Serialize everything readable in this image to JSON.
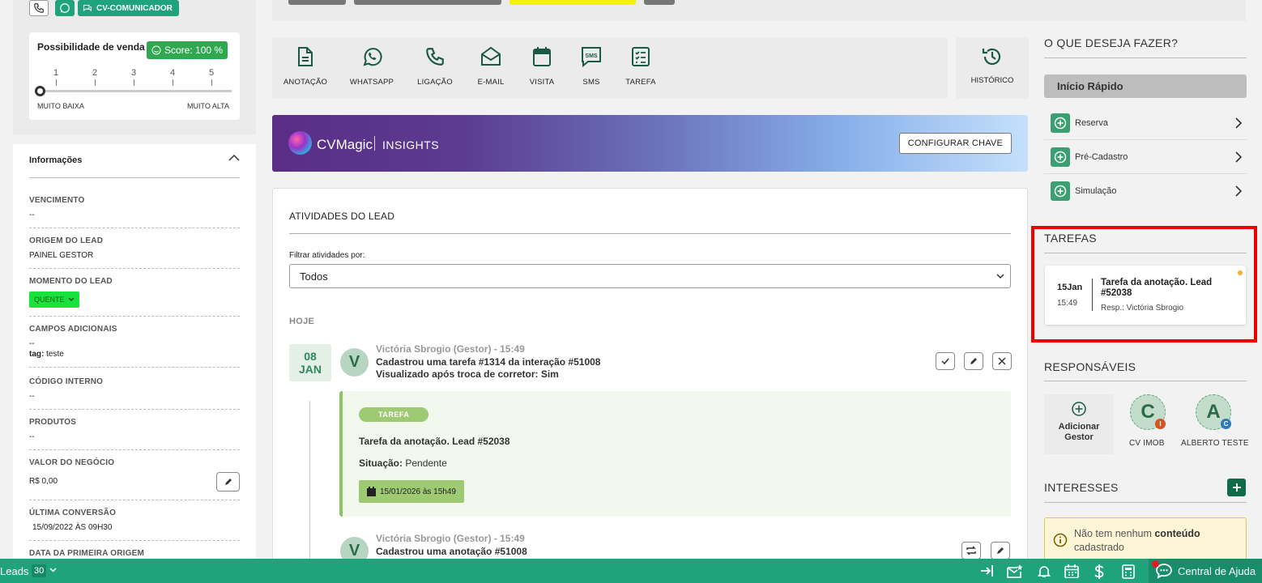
{
  "left_top": {
    "cv_comunicador": "CV-COMUNICADOR",
    "score_title": "Possibilidade de venda",
    "score_badge": "Score: 100 %",
    "scale": [
      "1",
      "2",
      "3",
      "4",
      "5"
    ],
    "scale_min": "MUITO BAIXA",
    "scale_max": "MUITO ALTA",
    "scale_value": 0
  },
  "info": {
    "title": "Informações",
    "vencimento_label": "VENCIMENTO",
    "vencimento_value": "--",
    "origem_label": "ORIGEM DO LEAD",
    "origem_value": "PAINEL GESTOR",
    "momento_label": "MOMENTO DO LEAD",
    "momento_value": "QUENTE",
    "campos_label": "CAMPOS ADICIONAIS",
    "campos_value": "--",
    "tag_label": "tag:",
    "tag_value": "teste",
    "codigo_label": "CÓDIGO INTERNO",
    "codigo_value": "--",
    "produtos_label": "PRODUTOS",
    "produtos_value": "--",
    "valor_label": "VALOR DO NEGÓCIO",
    "valor_value": "R$ 0,00",
    "ultima_label": "ÚLTIMA CONVERSÃO",
    "ultima_value": "15/09/2022 ÀS 09H30",
    "primeira_label": "DATA DA PRIMEIRA ORIGEM"
  },
  "actions": {
    "anotacao": "ANOTAÇÃO",
    "whatsapp": "WHATSAPP",
    "ligacao": "LIGAÇÃO",
    "email": "E-MAIL",
    "visita": "VISITA",
    "sms": "SMS",
    "tarefa": "TAREFA",
    "historico": "HISTÓRICO"
  },
  "magic": {
    "brand": "CVMagic",
    "insights": "INSIGHTS",
    "config_button": "CONFIGURAR CHAVE"
  },
  "activities": {
    "title": "ATIVIDADES DO LEAD",
    "filter_label": "Filtrar atividades por:",
    "filter_value": "Todos",
    "today": "HOJE",
    "date_day": "08",
    "date_month": "JAN",
    "entry1": {
      "avatar": "V",
      "author": "Victória Sbrogio (Gestor) - 15:49",
      "line1": "Cadastrou uma tarefa #1314 da interação #51008",
      "line2": "Visualizado após troca de corretor:  Sim"
    },
    "task": {
      "pill": "TAREFA",
      "title": "Tarefa da anotação. Lead #52038",
      "situacao_label": "Situação:",
      "situacao_value": "Pendente",
      "date": "15/01/2026 às 15h49"
    },
    "entry2": {
      "avatar": "V",
      "author": "Victória Sbrogio (Gestor) - 15:49",
      "line1": "Cadastrou uma anotação #51008"
    }
  },
  "right": {
    "header": "O QUE DESEJA FAZER?",
    "quick_start": "Início Rápido",
    "quick_items": [
      "Reserva",
      "Pré-Cadastro",
      "Simulação"
    ],
    "tarefas_header": "TAREFAS",
    "tarefa": {
      "day": "15Jan",
      "time": "15:49",
      "title": "Tarefa da anotação. Lead #52038",
      "resp": "Resp.: Victória Sbrogio"
    },
    "responsaveis_header": "RESPONSÁVEIS",
    "add_gestor": "Adicionar Gestor",
    "responsaveis": [
      {
        "initial": "C",
        "name": "CV IMOB",
        "badge": "I",
        "badge_color": "#d9531e"
      },
      {
        "initial": "A",
        "name": "ALBERTO TESTE",
        "badge": "C",
        "badge_color": "#2a7ab8"
      }
    ],
    "interesses_header": "INTERESSES",
    "interesses_empty_pre": "Não tem nenhum ",
    "interesses_empty_bold": "conteúdo",
    "interesses_empty_post": " cadastrado"
  },
  "bottom": {
    "leads_label": "Leads",
    "leads_count": "30",
    "help": "Central de Ajuda"
  },
  "colors": {
    "accent_green": "#1ea37a",
    "dark_green": "#0f6b48",
    "highlight_red": "#e00000",
    "quente_green": "#18e33d"
  }
}
